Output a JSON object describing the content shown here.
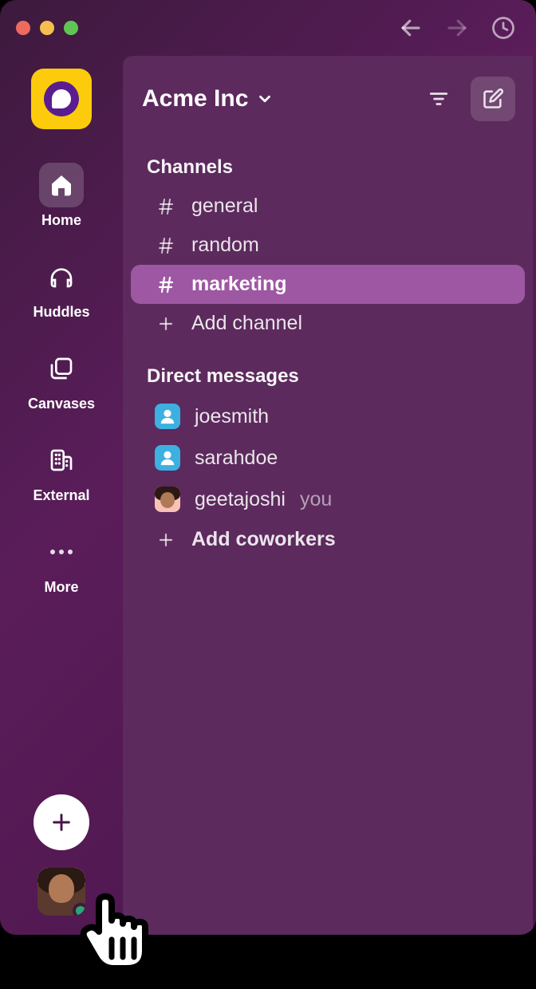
{
  "workspace_name": "Acme Inc",
  "rail": {
    "items": [
      {
        "label": "Home"
      },
      {
        "label": "Huddles"
      },
      {
        "label": "Canvases"
      },
      {
        "label": "External"
      },
      {
        "label": "More"
      }
    ]
  },
  "channels": {
    "header": "Channels",
    "items": [
      {
        "name": "general",
        "selected": false
      },
      {
        "name": "random",
        "selected": false
      },
      {
        "name": "marketing",
        "selected": true
      }
    ],
    "add_label": "Add channel"
  },
  "dms": {
    "header": "Direct messages",
    "items": [
      {
        "name": "joesmith",
        "you": false,
        "avatar_type": "generic"
      },
      {
        "name": "sarahdoe",
        "you": false,
        "avatar_type": "generic"
      },
      {
        "name": "geetajoshi",
        "you": true,
        "avatar_type": "photo"
      }
    ],
    "you_label": "you",
    "add_label": "Add coworkers"
  }
}
